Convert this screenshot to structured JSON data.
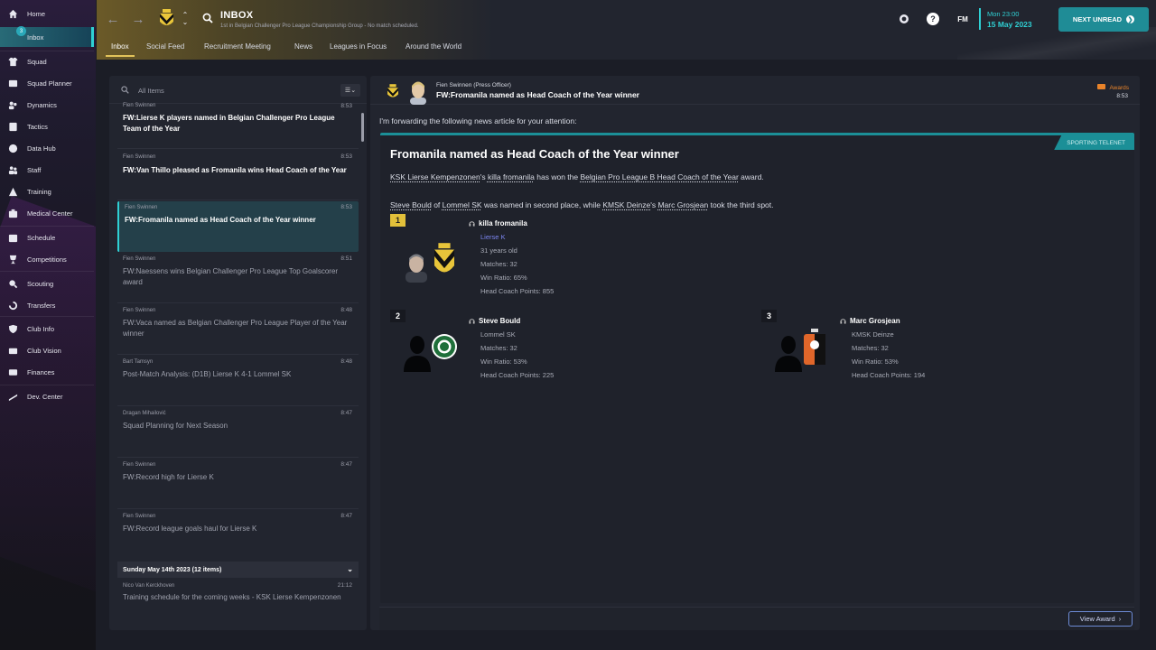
{
  "sidebar": {
    "items": [
      {
        "label": "Home",
        "icon": "home-icon"
      },
      {
        "label": "Inbox",
        "icon": "inbox-icon",
        "badge": "3",
        "active": true
      },
      {
        "label": "Squad",
        "icon": "shirt-icon"
      },
      {
        "label": "Squad Planner",
        "icon": "planner-icon"
      },
      {
        "label": "Dynamics",
        "icon": "dynamics-icon"
      },
      {
        "label": "Tactics",
        "icon": "tactics-icon"
      },
      {
        "label": "Data Hub",
        "icon": "data-hub-icon"
      },
      {
        "label": "Staff",
        "icon": "staff-icon"
      },
      {
        "label": "Training",
        "icon": "training-icon"
      },
      {
        "label": "Medical Center",
        "icon": "medical-icon"
      },
      {
        "label": "Schedule",
        "icon": "calendar-icon"
      },
      {
        "label": "Competitions",
        "icon": "trophy-icon"
      },
      {
        "label": "Scouting",
        "icon": "scouting-icon"
      },
      {
        "label": "Transfers",
        "icon": "transfers-icon"
      },
      {
        "label": "Club Info",
        "icon": "shield-icon"
      },
      {
        "label": "Club Vision",
        "icon": "vision-icon"
      },
      {
        "label": "Finances",
        "icon": "finances-icon"
      },
      {
        "label": "Dev. Center",
        "icon": "dev-center-icon"
      }
    ]
  },
  "header": {
    "title": "INBOX",
    "subtitle": "1st in Belgian Challenger Pro League Championship Group - No match scheduled.",
    "tabs": [
      "Inbox",
      "Social Feed",
      "Recruitment Meeting",
      "News",
      "Leagues in Focus",
      "Around the World"
    ],
    "active_tab": "Inbox",
    "fm_label": "FM",
    "date_time": "Mon 23:00",
    "date_day": "15 May 2023",
    "next_unread": "NEXT UNREAD",
    "accent": "#2fd0d4"
  },
  "list": {
    "search_placeholder": "All Items",
    "filter_icon": "list-filter-icon",
    "messages": [
      {
        "sender": "Fien Swinnen",
        "time": "8:53",
        "subject": "FW:Lierse K players named in Belgian Challenger Pro League Team of the Year",
        "unread": true
      },
      {
        "sender": "Fien Swinnen",
        "time": "8:53",
        "subject": "FW:Van Thillo pleased as Fromanila wins Head Coach of the Year",
        "unread": true
      },
      {
        "sender": "Fien Swinnen",
        "time": "8:53",
        "subject": "FW:Fromanila named as Head Coach of the Year winner",
        "unread": true,
        "selected": true
      },
      {
        "sender": "Fien Swinnen",
        "time": "8:51",
        "subject": "FW:Naessens wins Belgian Challenger Pro League Top Goalscorer award",
        "unread": false
      },
      {
        "sender": "Fien Swinnen",
        "time": "8:48",
        "subject": "FW:Vaca named as Belgian Challenger Pro League Player of the Year winner",
        "unread": false
      },
      {
        "sender": "Bart Tamsyn",
        "time": "8:48",
        "subject": "Post-Match Analysis: (D1B) Lierse K 4-1 Lommel SK",
        "unread": false
      },
      {
        "sender": "Dragan Mihailović",
        "time": "8:47",
        "subject": "Squad Planning for Next Season",
        "unread": false
      },
      {
        "sender": "Fien Swinnen",
        "time": "8:47",
        "subject": "FW:Record high for Lierse K",
        "unread": false
      },
      {
        "sender": "Fien Swinnen",
        "time": "8:47",
        "subject": "FW:Record league goals haul for Lierse K",
        "unread": false
      }
    ],
    "day_header": "Sunday May 14th 2023 (12 items)",
    "last_message": {
      "sender": "Nico Van Kerckhoven",
      "time": "21:12",
      "subject": "Training schedule for the coming weeks - KSK Lierse Kempenzonen"
    }
  },
  "detail": {
    "sender": "Fien Swinnen  (Press Officer)",
    "subject": "FW:Fromanila named as Head Coach of the Year winner",
    "tag": "Awards",
    "time": "8:53",
    "intro": "I'm forwarding the following news article for your attention:",
    "article": {
      "source": "SPORTING TELENET",
      "title": "Fromanila named as Head Coach of the Year winner",
      "p1": {
        "club": "KSK Lierse Kempenzonen",
        "t1": "'s ",
        "coach": "killa fromanila",
        "t2": " has won the ",
        "award": "Belgian Pro League B Head Coach of the Year",
        "t3": " award."
      },
      "p2": {
        "name1": "Steve Bould",
        "t1": " of ",
        "club1": "Lommel SK",
        "t2": " was named in second place, while ",
        "club2": "KMSK Deinze",
        "t3": "'s ",
        "name2": "Marc Grosjean",
        "t4": " took the third spot."
      },
      "winners": [
        {
          "rank": "1",
          "name": "killa fromanila",
          "club": "Lierse K",
          "age": "31 years old",
          "matches": "Matches: 32",
          "win_ratio": "Win Ratio: 65%",
          "points": "Head Coach Points: 855"
        },
        {
          "rank": "2",
          "name": "Steve Bould",
          "club": "Lommel SK",
          "matches": "Matches: 32",
          "win_ratio": "Win Ratio: 53%",
          "points": "Head Coach Points: 225"
        },
        {
          "rank": "3",
          "name": "Marc Grosjean",
          "club": "KMSK Deinze",
          "matches": "Matches: 32",
          "win_ratio": "Win Ratio: 53%",
          "points": "Head Coach Points: 194"
        }
      ]
    },
    "view_award": "View Award"
  }
}
